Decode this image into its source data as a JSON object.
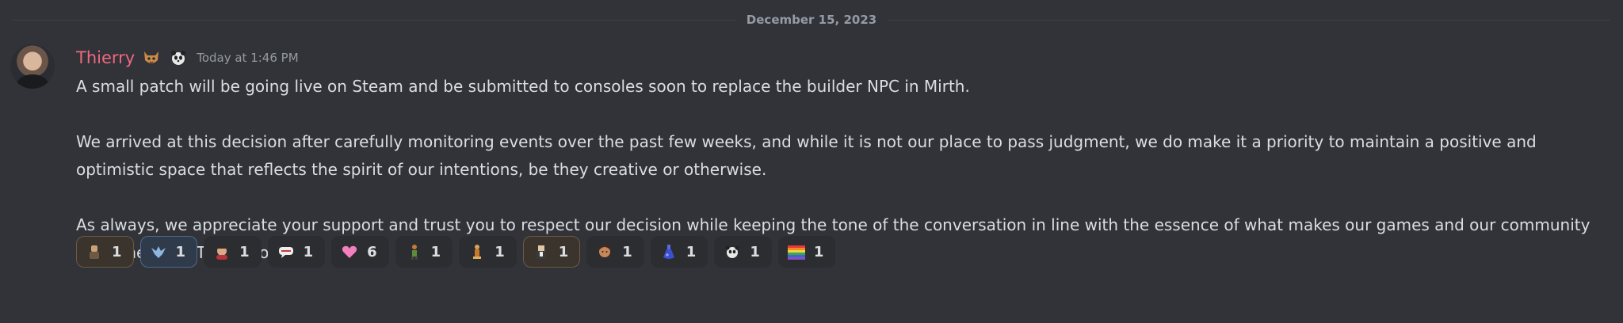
{
  "divider": {
    "date": "December 15, 2023"
  },
  "message": {
    "author": "Thierry",
    "timestamp": "Today at 1:46 PM",
    "paragraphs": [
      "A small patch will be going live on Steam and be submitted to consoles soon to replace the builder NPC in Mirth.",
      "We arrived at this decision after carefully monitoring events over the past few weeks, and while it is not our place to pass judgment, we do make it a priority to maintain a positive and optimistic space that reflects the spirit of our intentions, be they creative or otherwise.",
      "As always, we appreciate your support and trust you to respect our decision while keeping the tone of the conversation in line with the essence of what makes our games and our community what they are. Thank you."
    ]
  },
  "reactions": [
    {
      "icon": "character-emoji-icon",
      "count": "1"
    },
    {
      "icon": "winged-emblem-emoji-icon",
      "count": "1"
    },
    {
      "icon": "face-emoji-icon",
      "count": "1"
    },
    {
      "icon": "speech-bubble-emoji-icon",
      "count": "1"
    },
    {
      "icon": "pink-heart-emoji-icon",
      "count": "6"
    },
    {
      "icon": "figure-emoji-icon",
      "count": "1"
    },
    {
      "icon": "trophy-emoji-icon",
      "count": "1"
    },
    {
      "icon": "portrait-emoji-icon",
      "count": "1"
    },
    {
      "icon": "head-emoji-icon",
      "count": "1"
    },
    {
      "icon": "blue-potion-emoji-icon",
      "count": "1"
    },
    {
      "icon": "panda-emoji-icon",
      "count": "1"
    },
    {
      "icon": "rainbow-flag-emoji-icon",
      "count": "1"
    }
  ],
  "colors": {
    "background": "#313338",
    "username": "#f0687e",
    "text": "#dbdee1",
    "muted": "#949ba4",
    "reaction_bg": "#2b2d31"
  }
}
